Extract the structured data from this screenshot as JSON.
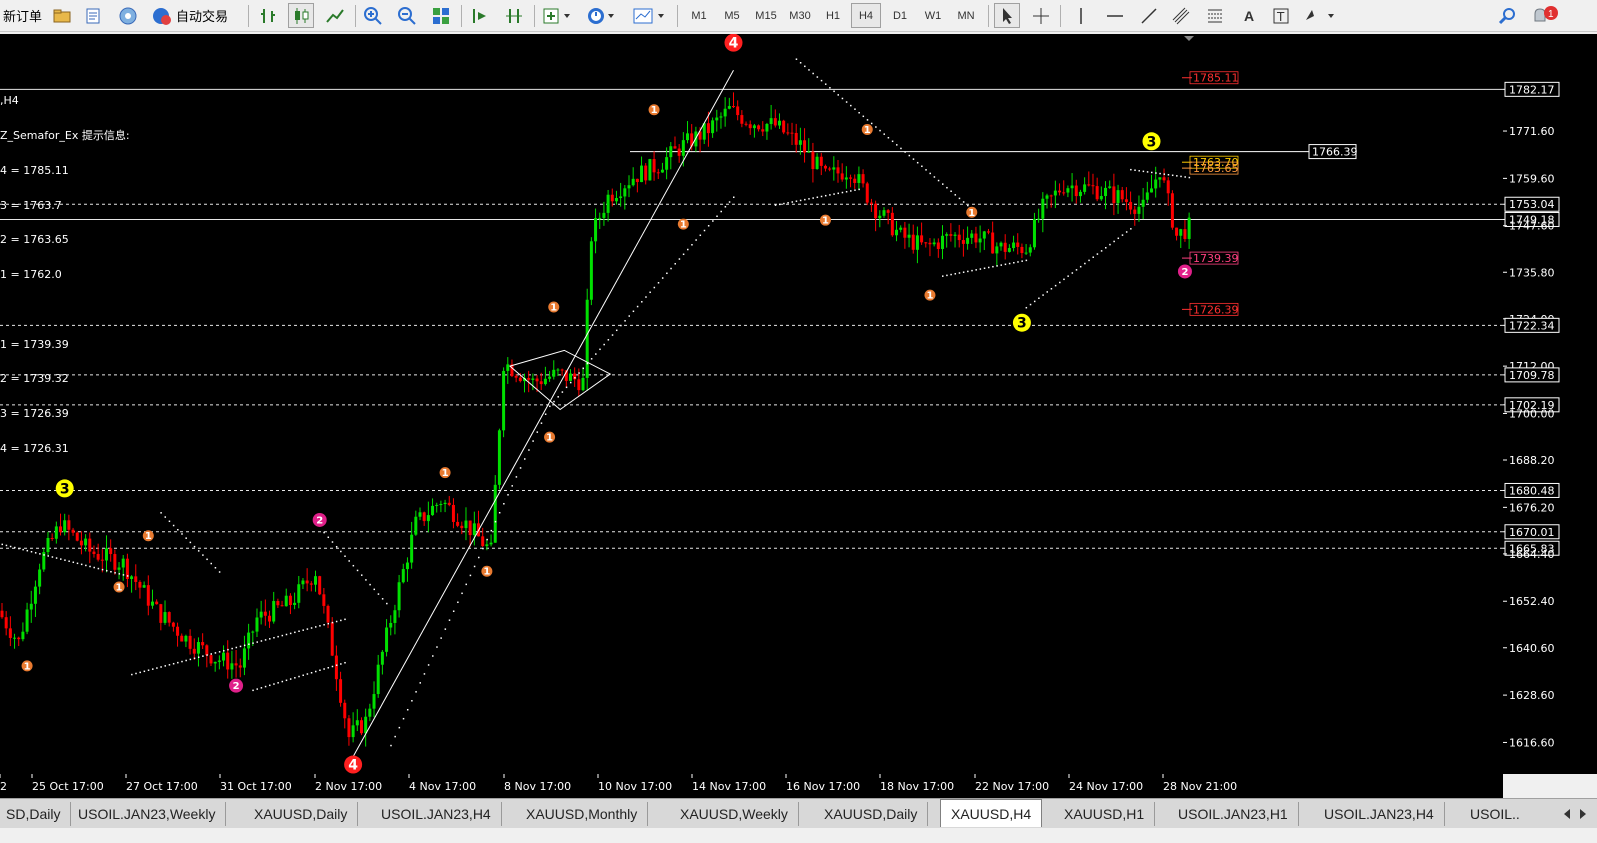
{
  "toolbar": {
    "new_order_label": "新订单",
    "auto_trade_label": "自动交易",
    "timeframes": [
      "M1",
      "M5",
      "M15",
      "M30",
      "H1",
      "H4",
      "D1",
      "W1",
      "MN"
    ],
    "active_timeframe": "H4",
    "notification_count": "1"
  },
  "chart": {
    "window_title": ",H4",
    "indicator_title": "Z_Semafor_Ex 提示信息:",
    "indicator_lines": [
      "4 = 1785.11",
      "3 = 1763.7",
      "2 = 1763.65",
      "1 = 1762.0",
      "",
      "1 = 1739.39",
      "2 = 1739.32",
      "3 = 1726.39",
      "4 = 1726.31"
    ],
    "price_scale_labels": [
      "1782.17",
      "1771.60",
      "1759.60",
      "1753.04",
      "1749.18",
      "1747.60",
      "1735.80",
      "1724.00",
      "1722.34",
      "1712.00",
      "1709.78",
      "1702.19",
      "1700.00",
      "1688.20",
      "1680.48",
      "1676.20",
      "1670.01",
      "1665.83",
      "1664.40",
      "1652.40",
      "1640.60",
      "1628.60",
      "1616.60"
    ],
    "highlight_labels": [
      "1782.17",
      "1753.04",
      "1749.18",
      "1722.34",
      "1709.78",
      "1702.19",
      "1680.48",
      "1670.01",
      "1665.83"
    ],
    "horizontal_lines": [
      {
        "price": 1782.17,
        "style": "solid"
      },
      {
        "price": 1753.04,
        "style": "dashed"
      },
      {
        "price": 1749.18,
        "style": "solid"
      },
      {
        "price": 1722.34,
        "style": "dashed"
      },
      {
        "price": 1709.78,
        "style": "dashed"
      },
      {
        "price": 1702.19,
        "style": "dashed"
      },
      {
        "price": 1680.48,
        "style": "dashed"
      },
      {
        "price": 1670.01,
        "style": "dashed"
      },
      {
        "price": 1665.83,
        "style": "dashed"
      }
    ],
    "resistance_line": {
      "price": 1766.39,
      "label": "1766.39"
    },
    "right_labels": [
      {
        "text": "1785.11",
        "price": 1785.11,
        "color": "#ff3030"
      },
      {
        "text": "1763.70",
        "price": 1763.7,
        "color": "#ffcc00"
      },
      {
        "text": "1763.65",
        "price": 1762.2,
        "color": "#ff9a40"
      },
      {
        "text": "1739.39",
        "price": 1739.39,
        "color": "#ff4080"
      },
      {
        "text": "1726.39",
        "price": 1726.39,
        "color": "#ff3030"
      }
    ],
    "time_labels": [
      "2",
      "25 Oct 17:00",
      "27 Oct 17:00",
      "31 Oct 17:00",
      "2 Nov 17:00",
      "4 Nov 17:00",
      "8 Nov 17:00",
      "10 Nov 17:00",
      "14 Nov 17:00",
      "16 Nov 17:00",
      "18 Nov 17:00",
      "22 Nov 17:00",
      "24 Nov 17:00",
      "28 Nov 21:00"
    ],
    "semafor_markers": [
      {
        "label": "3",
        "color": "#ffff00",
        "bar": 15,
        "price": 1681
      },
      {
        "label": "1",
        "color": "#e87a30",
        "bar": 35,
        "price": 1669
      },
      {
        "label": "1",
        "color": "#e87a30",
        "bar": 28,
        "price": 1656
      },
      {
        "label": "1",
        "color": "#e87a30",
        "bar": 6,
        "price": 1636
      },
      {
        "label": "2",
        "color": "#e0208a",
        "bar": 56,
        "price": 1631
      },
      {
        "label": "2",
        "color": "#e0208a",
        "bar": 76,
        "price": 1673
      },
      {
        "label": "4",
        "color": "#ff2020",
        "bar": 84,
        "price": 1611
      },
      {
        "label": "1",
        "color": "#e87a30",
        "bar": 106,
        "price": 1685
      },
      {
        "label": "1",
        "color": "#e87a30",
        "bar": 116,
        "price": 1660
      },
      {
        "label": "1",
        "color": "#e87a30",
        "bar": 131,
        "price": 1694
      },
      {
        "label": "1",
        "color": "#e87a30",
        "bar": 132,
        "price": 1727
      },
      {
        "label": "1",
        "color": "#e87a30",
        "bar": 156,
        "price": 1777
      },
      {
        "label": "1",
        "color": "#e87a30",
        "bar": 163,
        "price": 1748
      },
      {
        "label": "4",
        "color": "#ff2020",
        "bar": 175,
        "price": 1794
      },
      {
        "label": "1",
        "color": "#e87a30",
        "bar": 197,
        "price": 1749
      },
      {
        "label": "1",
        "color": "#e87a30",
        "bar": 207,
        "price": 1772
      },
      {
        "label": "1",
        "color": "#e87a30",
        "bar": 222,
        "price": 1730
      },
      {
        "label": "1",
        "color": "#e87a30",
        "bar": 232,
        "price": 1751
      },
      {
        "label": "3",
        "color": "#ffff00",
        "bar": 244,
        "price": 1723
      },
      {
        "label": "3",
        "color": "#ffff00",
        "bar": 275,
        "price": 1769
      },
      {
        "label": "2",
        "color": "#e0208a",
        "bar": 283,
        "price": 1736
      }
    ]
  },
  "tabs": [
    "SD,Daily",
    "USOIL.JAN23,Weekly",
    "XAUUSD,Daily",
    "USOIL.JAN23,H4",
    "XAUUSD,Monthly",
    "XAUUSD,Weekly",
    "XAUUSD,Daily",
    "XAUUSD,H4",
    "XAUUSD,H1",
    "USOIL.JAN23,H1",
    "USOIL.JAN23,H4",
    "USOIL.."
  ],
  "active_tab": "XAUUSD,H4",
  "colors": {
    "bull": "#00e000",
    "bear": "#ff0000",
    "background": "#000000",
    "grid_line": "#ffffff",
    "accent": "#ffff00"
  }
}
